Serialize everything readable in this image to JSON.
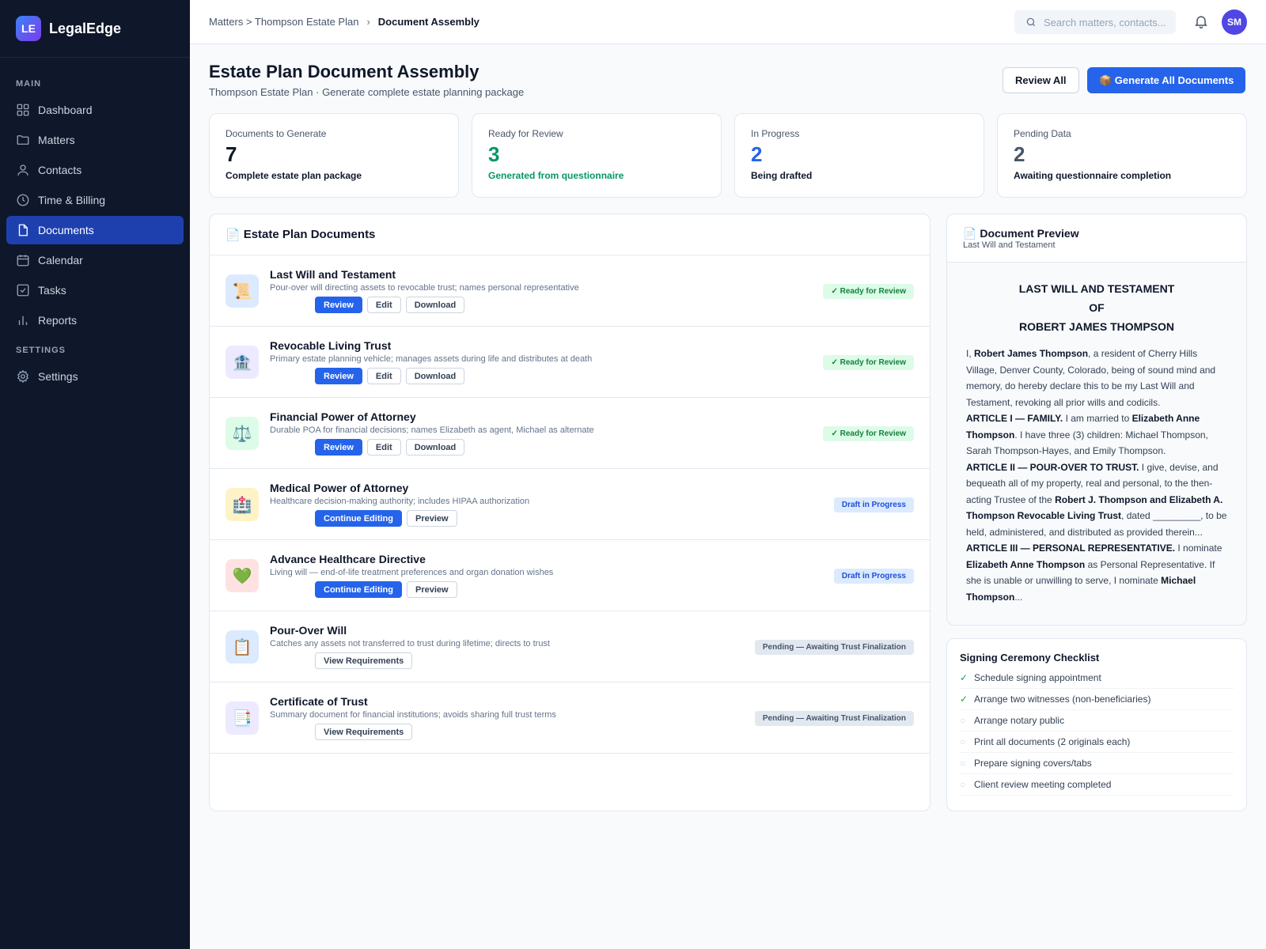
{
  "brand": {
    "logo": "LE",
    "name": "LegalEdge"
  },
  "nav": {
    "main_label": "MAIN",
    "settings_label": "SETTINGS",
    "items": [
      {
        "label": "Dashboard",
        "icon": "dashboard-icon"
      },
      {
        "label": "Matters",
        "icon": "folder-icon"
      },
      {
        "label": "Contacts",
        "icon": "user-icon"
      },
      {
        "label": "Time & Billing",
        "icon": "clock-icon"
      },
      {
        "label": "Documents",
        "icon": "document-icon",
        "active": true
      },
      {
        "label": "Calendar",
        "icon": "calendar-icon"
      },
      {
        "label": "Tasks",
        "icon": "checkbox-icon"
      },
      {
        "label": "Reports",
        "icon": "bar-chart-icon"
      }
    ],
    "settings": {
      "label": "Settings",
      "icon": "gear-icon"
    }
  },
  "topbar": {
    "breadcrumb": {
      "path": "Matters > Thompson Estate Plan",
      "separator": "›",
      "current": "Document Assembly"
    },
    "search_placeholder": "Search matters, contacts...",
    "avatar": "SM"
  },
  "header": {
    "title": "Estate Plan Document Assembly",
    "subtitle": "Thompson Estate Plan · Generate complete estate planning package",
    "review_all": "Review All",
    "generate_all": "📦 Generate All Documents"
  },
  "stats": [
    {
      "label": "Documents to Generate",
      "value": "7",
      "sub": "Complete estate plan package",
      "color": "#0f172a",
      "sub_color": "#0f172a"
    },
    {
      "label": "Ready for Review",
      "value": "3",
      "sub": "Generated from questionnaire",
      "color": "#059669",
      "sub_color": "#059669"
    },
    {
      "label": "In Progress",
      "value": "2",
      "sub": "Being drafted",
      "color": "#2563eb",
      "sub_color": "#0f172a"
    },
    {
      "label": "Pending Data",
      "value": "2",
      "sub": "Awaiting questionnaire completion",
      "color": "#475569",
      "sub_color": "#0f172a"
    }
  ],
  "documents": {
    "title": "Estate Plan Documents",
    "title_icon": "📄",
    "rows": [
      {
        "icon": "📜",
        "icon_bg": "#dbeafe",
        "title": "Last Will and Testament",
        "desc": "Pour-over will directing assets to revocable trust; names personal representative",
        "actions": [
          "Review",
          "Edit",
          "Download"
        ],
        "status": "✓ Ready for Review",
        "status_type": "ready"
      },
      {
        "icon": "🏦",
        "icon_bg": "#ede9fe",
        "title": "Revocable Living Trust",
        "desc": "Primary estate planning vehicle; manages assets during life and distributes at death",
        "actions": [
          "Review",
          "Edit",
          "Download"
        ],
        "status": "✓ Ready for Review",
        "status_type": "ready"
      },
      {
        "icon": "⚖️",
        "icon_bg": "#dcfce7",
        "title": "Financial Power of Attorney",
        "desc": "Durable POA for financial decisions; names Elizabeth as agent, Michael as alternate",
        "actions": [
          "Review",
          "Edit",
          "Download"
        ],
        "status": "✓ Ready for Review",
        "status_type": "ready"
      },
      {
        "icon": "🏥",
        "icon_bg": "#fef3c7",
        "title": "Medical Power of Attorney",
        "desc": "Healthcare decision-making authority; includes HIPAA authorization",
        "actions": [
          "Continue Editing",
          "Preview"
        ],
        "status": "Draft in Progress",
        "status_type": "draft"
      },
      {
        "icon": "💚",
        "icon_bg": "#fee2e2",
        "title": "Advance Healthcare Directive",
        "desc": "Living will — end-of-life treatment preferences and organ donation wishes",
        "actions": [
          "Continue Editing",
          "Preview"
        ],
        "status": "Draft in Progress",
        "status_type": "draft"
      },
      {
        "icon": "📋",
        "icon_bg": "#dbeafe",
        "title": "Pour-Over Will",
        "desc": "Catches any assets not transferred to trust during lifetime; directs to trust",
        "actions": [
          "View Requirements"
        ],
        "status": "Pending — Awaiting Trust Finalization",
        "status_type": "pending"
      },
      {
        "icon": "📑",
        "icon_bg": "#ede9fe",
        "title": "Certificate of Trust",
        "desc": "Summary document for financial institutions; avoids sharing full trust terms",
        "actions": [
          "View Requirements"
        ],
        "status": "Pending — Awaiting Trust Finalization",
        "status_type": "pending"
      }
    ]
  },
  "preview": {
    "title": "Document Preview",
    "title_icon": "📄",
    "subtitle": "Last Will and Testament",
    "heading": [
      "LAST WILL AND TESTAMENT",
      "OF",
      "ROBERT JAMES THOMPSON"
    ],
    "body": [
      [
        "I, ",
        {
          "b": "Robert James Thompson"
        },
        ", a resident of Cherry Hills Village, Denver County, Colorado, being of sound mind and memory, do hereby declare this to be my Last Will and Testament, revoking all prior wills and codicils."
      ],
      [
        {
          "b": "ARTICLE I — FAMILY."
        },
        " I am married to ",
        {
          "b": "Elizabeth Anne Thompson"
        },
        ". I have three (3) children: Michael Thompson, Sarah Thompson-Hayes, and Emily Thompson."
      ],
      [
        {
          "b": "ARTICLE II — POUR-OVER TO TRUST."
        },
        " I give, devise, and bequeath all of my property, real and personal, to the then-acting Trustee of the ",
        {
          "b": "Robert J. Thompson and Elizabeth A. Thompson Revocable Living Trust"
        },
        ", dated _________, to be held, administered, and distributed as provided therein..."
      ],
      [
        {
          "b": "ARTICLE III — PERSONAL REPRESENTATIVE."
        },
        " I nominate ",
        {
          "b": "Elizabeth Anne Thompson"
        },
        " as Personal Representative. If she is unable or unwilling to serve, I nominate ",
        {
          "b": "Michael Thompson"
        },
        "..."
      ]
    ]
  },
  "checklist": {
    "title": "Signing Ceremony Checklist",
    "items": [
      {
        "label": "Schedule signing appointment",
        "done": true
      },
      {
        "label": "Arrange two witnesses (non-beneficiaries)",
        "done": true
      },
      {
        "label": "Arrange notary public",
        "done": false
      },
      {
        "label": "Print all documents (2 originals each)",
        "done": false
      },
      {
        "label": "Prepare signing covers/tabs",
        "done": false
      },
      {
        "label": "Client review meeting completed",
        "done": false
      }
    ]
  }
}
